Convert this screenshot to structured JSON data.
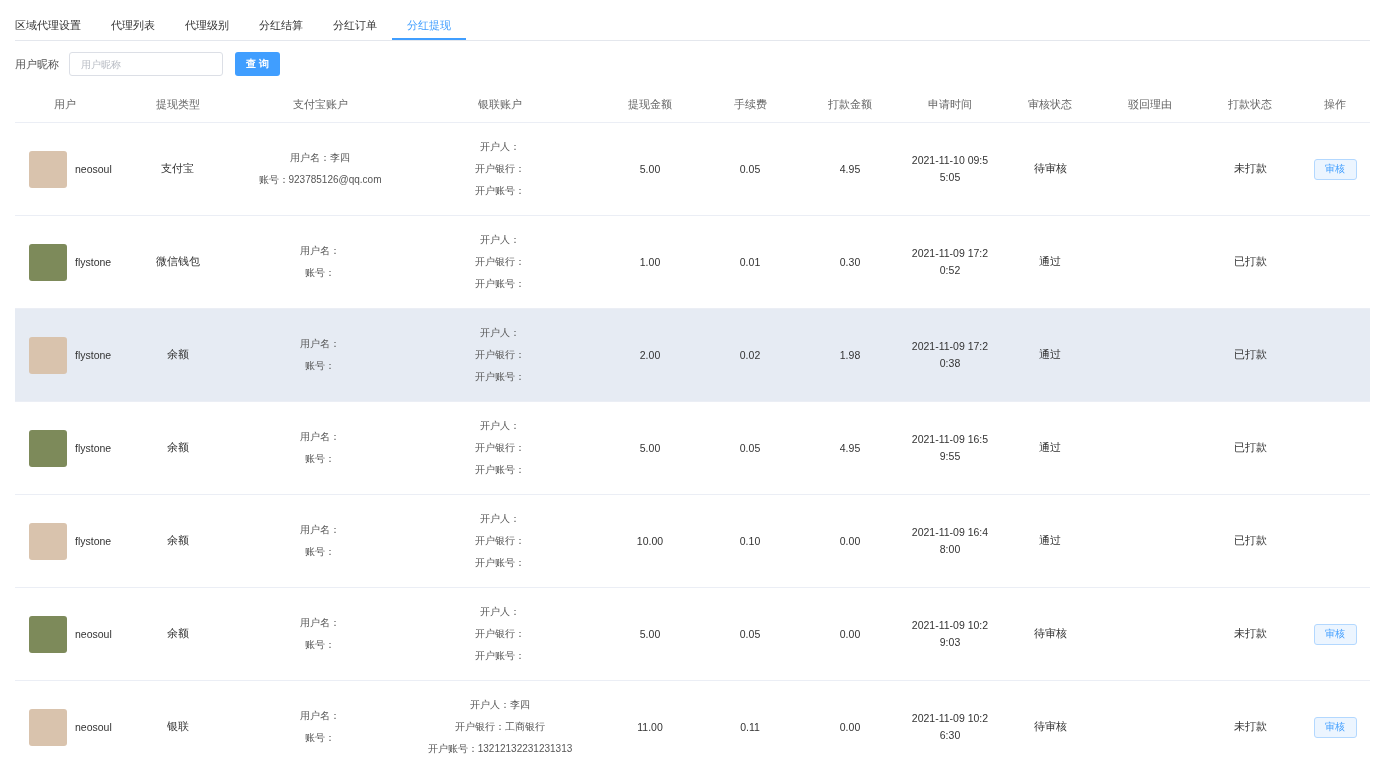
{
  "tabs": [
    {
      "label": "区域代理设置",
      "selected": false
    },
    {
      "label": "代理列表",
      "selected": false
    },
    {
      "label": "代理级别",
      "selected": false
    },
    {
      "label": "分红结算",
      "selected": false
    },
    {
      "label": "分红订单",
      "selected": false
    },
    {
      "label": "分红提现",
      "selected": true
    }
  ],
  "search": {
    "label": "用户昵称",
    "placeholder": "用户昵称",
    "button": "查 询"
  },
  "table": {
    "columns": [
      "用户",
      "提现类型",
      "支付宝账户",
      "银联账户",
      "提现金额",
      "手续费",
      "打款金额",
      "申请时间",
      "审核状态",
      "驳回理由",
      "打款状态",
      "操作"
    ],
    "rows": [
      {
        "user": "neosoul",
        "type": "支付宝",
        "alipay": [
          "用户名：李四",
          "账号：923785126@qq.com"
        ],
        "bank": [
          "开户人：",
          "开户银行：",
          "开户账号："
        ],
        "amount": "5.00",
        "fee": "0.05",
        "paid": "4.95",
        "time": "2021-11-10 09:55:05",
        "audit": "待审核",
        "payment": "未打款",
        "action": "审核",
        "highlighted": false
      },
      {
        "user": "flystone",
        "type": "微信钱包",
        "alipay": [
          "用户名：",
          "账号："
        ],
        "bank": [
          "开户人：",
          "开户银行：",
          "开户账号："
        ],
        "amount": "1.00",
        "fee": "0.01",
        "paid": "0.30",
        "time": "2021-11-09 17:20:52",
        "audit": "通过",
        "payment": "已打款",
        "highlighted": false
      },
      {
        "user": "flystone",
        "type": "余额",
        "alipay": [
          "用户名：",
          "账号："
        ],
        "bank": [
          "开户人：",
          "开户银行：",
          "开户账号："
        ],
        "amount": "2.00",
        "fee": "0.02",
        "paid": "1.98",
        "time": "2021-11-09 17:20:38",
        "audit": "通过",
        "payment": "已打款",
        "highlighted": true
      },
      {
        "user": "flystone",
        "type": "余额",
        "alipay": [
          "用户名：",
          "账号："
        ],
        "bank": [
          "开户人：",
          "开户银行：",
          "开户账号："
        ],
        "amount": "5.00",
        "fee": "0.05",
        "paid": "4.95",
        "time": "2021-11-09 16:59:55",
        "audit": "通过",
        "payment": "已打款",
        "highlighted": false
      },
      {
        "user": "flystone",
        "type": "余额",
        "alipay": [
          "用户名：",
          "账号："
        ],
        "bank": [
          "开户人：",
          "开户银行：",
          "开户账号："
        ],
        "amount": "10.00",
        "fee": "0.10",
        "paid": "0.00",
        "time": "2021-11-09 16:48:00",
        "audit": "通过",
        "payment": "已打款",
        "highlighted": false
      },
      {
        "user": "neosoul",
        "type": "余额",
        "alipay": [
          "用户名：",
          "账号："
        ],
        "bank": [
          "开户人：",
          "开户银行：",
          "开户账号："
        ],
        "amount": "5.00",
        "fee": "0.05",
        "paid": "0.00",
        "time": "2021-11-09 10:29:03",
        "audit": "待审核",
        "payment": "未打款",
        "action": "审核",
        "highlighted": false
      },
      {
        "user": "neosoul",
        "type": "银联",
        "alipay": [
          "用户名：",
          "账号："
        ],
        "bank": [
          "开户人：李四",
          "开户银行：工商银行",
          "开户账号：13212132231231313"
        ],
        "amount": "11.00",
        "fee": "0.11",
        "paid": "0.00",
        "time": "2021-11-09 10:26:30",
        "audit": "待审核",
        "payment": "未打款",
        "action": "审核",
        "highlighted": false
      }
    ]
  }
}
